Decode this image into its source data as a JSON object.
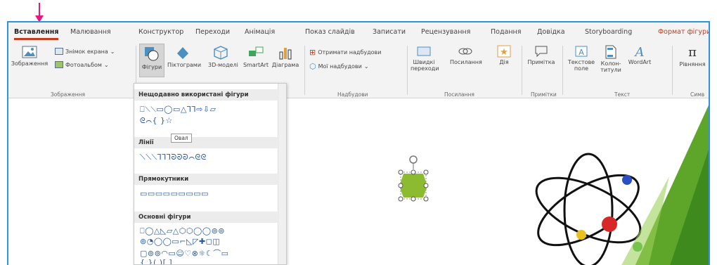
{
  "tabs": [
    "Вставлення",
    "Малювання",
    "Конструктор",
    "Переходи",
    "Анімація",
    "Показ слайдів",
    "Записати",
    "Рецензування",
    "Подання",
    "Довідка",
    "Storyboarding",
    "Формат фігури"
  ],
  "ribbon": {
    "images": {
      "label": "Зображення",
      "screenshot": "Знімок екрана",
      "album": "Фотоальбом",
      "group": "Зображення"
    },
    "shapes": "Фігури",
    "icons": "Піктограми",
    "models3d": "3D-моделі",
    "smartart": "SmartArt",
    "chart": "Діаграма",
    "addins": {
      "get": "Отримати надбудови",
      "my": "Мої надбудови",
      "group": "Надбудови"
    },
    "links": {
      "zoom": "Швидкі переходи",
      "link": "Посилання",
      "action": "Дія",
      "group": "Посилання"
    },
    "comments": {
      "comment": "Примітка",
      "group": "Примітки"
    },
    "text": {
      "textbox": "Текстове поле",
      "header": "Колон- титули",
      "wordart": "WordArt",
      "group": "Текст"
    },
    "symbols": {
      "equation": "Рівняння",
      "group": "Симв"
    }
  },
  "dropdown": {
    "recent": "Нещодавно використані фігури",
    "lines": "Лінії",
    "rects": "Прямокутники",
    "basic": "Основні фігури",
    "recent_row1": "⎕⟍⟍▭◯▭△⅂⅂⇨⇩▱",
    "recent_row2": "ᘓ⌒{ }☆",
    "lines_row": "⟍⟍⟍⅂⅂⅂ᘐᘐᘐ⌒ᘓᘓ",
    "rects_row": "▭▭▭▭▭▭▭▭▭",
    "basic_row1": "⎕◯△◺▱△⬡⬡◯◯⊚⊚",
    "basic_row2": "⊚◔◯◯▭⌐◺◸✚◻◫",
    "basic_row3": "▢⊚⊚◠▭☺♡⊗☼☾⌒▭",
    "basic_row4": "{ }( )[ ]"
  },
  "tooltip": "Овал",
  "colors": {
    "accent": "#c43e1c",
    "frame": "#2e93e0",
    "arrow": "#e6197a",
    "shape": "#8dbb2f"
  }
}
